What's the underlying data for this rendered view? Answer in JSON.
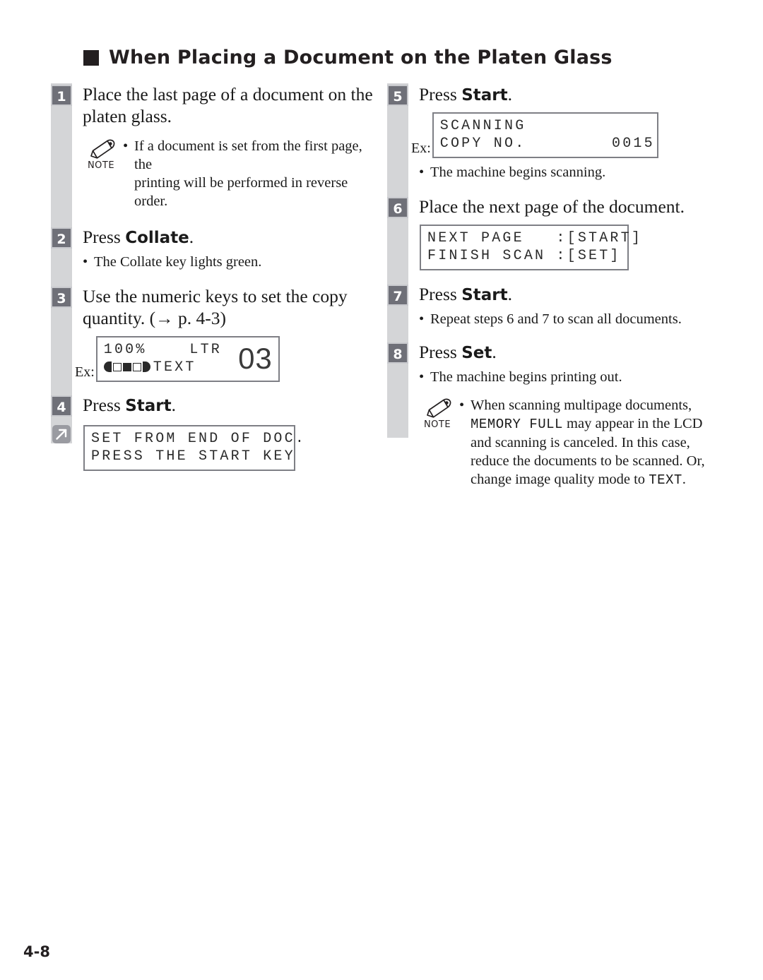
{
  "heading": {
    "bullet_icon": "filled-square",
    "title": "When Placing a Document on the Platen Glass"
  },
  "page_number": "4-8",
  "jump_icon": "diagonal-arrow-up-right-icon",
  "note_icon": "pencil-icon",
  "note_label": "NOTE",
  "left_column": {
    "steps": [
      {
        "number": "1",
        "text_line1": "Place the last page of a document on the",
        "text_line2": "platen glass.",
        "note": {
          "bullet": "•",
          "line1": "If a document is set from the first page, the",
          "line2": "printing will be performed in reverse order."
        }
      },
      {
        "number": "2",
        "prefix": "Press ",
        "keyword": "Collate",
        "suffix": ".",
        "bullets": [
          {
            "dot": "•",
            "text": "The Collate key lights green."
          }
        ]
      },
      {
        "number": "3",
        "text_line1": "Use the numeric keys to set the copy",
        "text_line2": "quantity. (→ p. 4-3)",
        "lcd": {
          "ex_label": "Ex:",
          "line1": "100%    LTR",
          "line2_icon": "density-indicator-icon",
          "line2": "TEXT",
          "counter": "03"
        }
      },
      {
        "number": "4",
        "prefix": "Press ",
        "keyword": "Start",
        "suffix": ".",
        "lcd": {
          "line1": "SET FROM END OF DOC.",
          "line2": "PRESS THE START KEY"
        }
      }
    ]
  },
  "right_column": {
    "steps": [
      {
        "number": "5",
        "prefix": "Press ",
        "keyword": "Start",
        "suffix": ".",
        "lcd": {
          "ex_label": "Ex:",
          "line1": "SCANNING",
          "line2": "COPY NO.        0015"
        },
        "bullets": [
          {
            "dot": "•",
            "text": "The machine begins scanning."
          }
        ]
      },
      {
        "number": "6",
        "text_line1": "Place the next page of the document.",
        "lcd": {
          "line1": "NEXT PAGE   :[START]",
          "line2": "FINISH SCAN :[SET]"
        }
      },
      {
        "number": "7",
        "prefix": "Press ",
        "keyword": "Start",
        "suffix": ".",
        "bullets": [
          {
            "dot": "•",
            "text": "Repeat steps 6 and 7 to scan all documents."
          }
        ]
      },
      {
        "number": "8",
        "prefix": "Press ",
        "keyword": "Set",
        "suffix": ".",
        "bullets": [
          {
            "dot": "•",
            "text": "The machine begins printing out."
          }
        ],
        "note": {
          "bullet": "•",
          "line1_a": "When scanning multipage documents,",
          "line2_mono": "MEMORY FULL",
          "line2_b": " may appear in the LCD",
          "line3": "and scanning is canceled. In this case,",
          "line4": "reduce the documents to be scanned. Or,",
          "line5_a": "change image quality mode to ",
          "line5_mono": "TEXT",
          "line5_b": "."
        }
      }
    ]
  }
}
